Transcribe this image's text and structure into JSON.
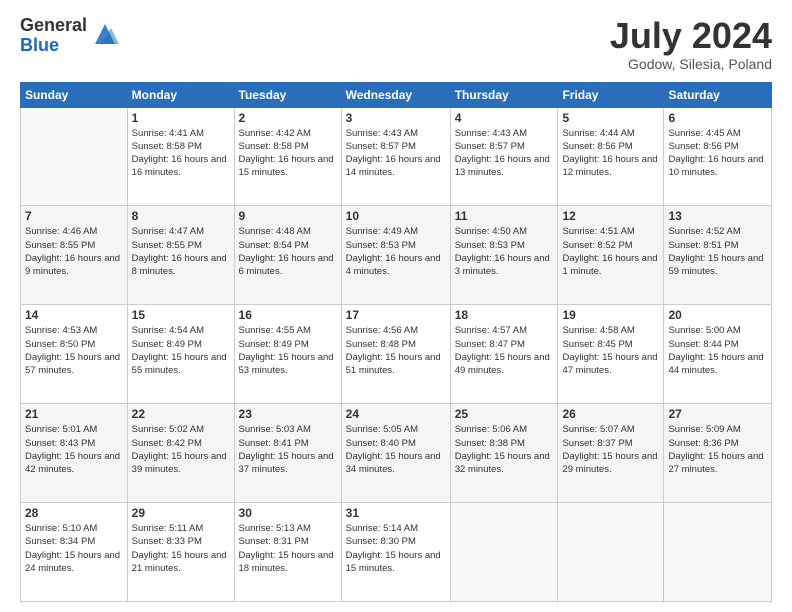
{
  "header": {
    "logo_general": "General",
    "logo_blue": "Blue",
    "month_title": "July 2024",
    "location": "Godow, Silesia, Poland"
  },
  "weekdays": [
    "Sunday",
    "Monday",
    "Tuesday",
    "Wednesday",
    "Thursday",
    "Friday",
    "Saturday"
  ],
  "weeks": [
    [
      {
        "day": "",
        "sunrise": "",
        "sunset": "",
        "daylight": ""
      },
      {
        "day": "1",
        "sunrise": "Sunrise: 4:41 AM",
        "sunset": "Sunset: 8:58 PM",
        "daylight": "Daylight: 16 hours and 16 minutes."
      },
      {
        "day": "2",
        "sunrise": "Sunrise: 4:42 AM",
        "sunset": "Sunset: 8:58 PM",
        "daylight": "Daylight: 16 hours and 15 minutes."
      },
      {
        "day": "3",
        "sunrise": "Sunrise: 4:43 AM",
        "sunset": "Sunset: 8:57 PM",
        "daylight": "Daylight: 16 hours and 14 minutes."
      },
      {
        "day": "4",
        "sunrise": "Sunrise: 4:43 AM",
        "sunset": "Sunset: 8:57 PM",
        "daylight": "Daylight: 16 hours and 13 minutes."
      },
      {
        "day": "5",
        "sunrise": "Sunrise: 4:44 AM",
        "sunset": "Sunset: 8:56 PM",
        "daylight": "Daylight: 16 hours and 12 minutes."
      },
      {
        "day": "6",
        "sunrise": "Sunrise: 4:45 AM",
        "sunset": "Sunset: 8:56 PM",
        "daylight": "Daylight: 16 hours and 10 minutes."
      }
    ],
    [
      {
        "day": "7",
        "sunrise": "Sunrise: 4:46 AM",
        "sunset": "Sunset: 8:55 PM",
        "daylight": "Daylight: 16 hours and 9 minutes."
      },
      {
        "day": "8",
        "sunrise": "Sunrise: 4:47 AM",
        "sunset": "Sunset: 8:55 PM",
        "daylight": "Daylight: 16 hours and 8 minutes."
      },
      {
        "day": "9",
        "sunrise": "Sunrise: 4:48 AM",
        "sunset": "Sunset: 8:54 PM",
        "daylight": "Daylight: 16 hours and 6 minutes."
      },
      {
        "day": "10",
        "sunrise": "Sunrise: 4:49 AM",
        "sunset": "Sunset: 8:53 PM",
        "daylight": "Daylight: 16 hours and 4 minutes."
      },
      {
        "day": "11",
        "sunrise": "Sunrise: 4:50 AM",
        "sunset": "Sunset: 8:53 PM",
        "daylight": "Daylight: 16 hours and 3 minutes."
      },
      {
        "day": "12",
        "sunrise": "Sunrise: 4:51 AM",
        "sunset": "Sunset: 8:52 PM",
        "daylight": "Daylight: 16 hours and 1 minute."
      },
      {
        "day": "13",
        "sunrise": "Sunrise: 4:52 AM",
        "sunset": "Sunset: 8:51 PM",
        "daylight": "Daylight: 15 hours and 59 minutes."
      }
    ],
    [
      {
        "day": "14",
        "sunrise": "Sunrise: 4:53 AM",
        "sunset": "Sunset: 8:50 PM",
        "daylight": "Daylight: 15 hours and 57 minutes."
      },
      {
        "day": "15",
        "sunrise": "Sunrise: 4:54 AM",
        "sunset": "Sunset: 8:49 PM",
        "daylight": "Daylight: 15 hours and 55 minutes."
      },
      {
        "day": "16",
        "sunrise": "Sunrise: 4:55 AM",
        "sunset": "Sunset: 8:49 PM",
        "daylight": "Daylight: 15 hours and 53 minutes."
      },
      {
        "day": "17",
        "sunrise": "Sunrise: 4:56 AM",
        "sunset": "Sunset: 8:48 PM",
        "daylight": "Daylight: 15 hours and 51 minutes."
      },
      {
        "day": "18",
        "sunrise": "Sunrise: 4:57 AM",
        "sunset": "Sunset: 8:47 PM",
        "daylight": "Daylight: 15 hours and 49 minutes."
      },
      {
        "day": "19",
        "sunrise": "Sunrise: 4:58 AM",
        "sunset": "Sunset: 8:45 PM",
        "daylight": "Daylight: 15 hours and 47 minutes."
      },
      {
        "day": "20",
        "sunrise": "Sunrise: 5:00 AM",
        "sunset": "Sunset: 8:44 PM",
        "daylight": "Daylight: 15 hours and 44 minutes."
      }
    ],
    [
      {
        "day": "21",
        "sunrise": "Sunrise: 5:01 AM",
        "sunset": "Sunset: 8:43 PM",
        "daylight": "Daylight: 15 hours and 42 minutes."
      },
      {
        "day": "22",
        "sunrise": "Sunrise: 5:02 AM",
        "sunset": "Sunset: 8:42 PM",
        "daylight": "Daylight: 15 hours and 39 minutes."
      },
      {
        "day": "23",
        "sunrise": "Sunrise: 5:03 AM",
        "sunset": "Sunset: 8:41 PM",
        "daylight": "Daylight: 15 hours and 37 minutes."
      },
      {
        "day": "24",
        "sunrise": "Sunrise: 5:05 AM",
        "sunset": "Sunset: 8:40 PM",
        "daylight": "Daylight: 15 hours and 34 minutes."
      },
      {
        "day": "25",
        "sunrise": "Sunrise: 5:06 AM",
        "sunset": "Sunset: 8:38 PM",
        "daylight": "Daylight: 15 hours and 32 minutes."
      },
      {
        "day": "26",
        "sunrise": "Sunrise: 5:07 AM",
        "sunset": "Sunset: 8:37 PM",
        "daylight": "Daylight: 15 hours and 29 minutes."
      },
      {
        "day": "27",
        "sunrise": "Sunrise: 5:09 AM",
        "sunset": "Sunset: 8:36 PM",
        "daylight": "Daylight: 15 hours and 27 minutes."
      }
    ],
    [
      {
        "day": "28",
        "sunrise": "Sunrise: 5:10 AM",
        "sunset": "Sunset: 8:34 PM",
        "daylight": "Daylight: 15 hours and 24 minutes."
      },
      {
        "day": "29",
        "sunrise": "Sunrise: 5:11 AM",
        "sunset": "Sunset: 8:33 PM",
        "daylight": "Daylight: 15 hours and 21 minutes."
      },
      {
        "day": "30",
        "sunrise": "Sunrise: 5:13 AM",
        "sunset": "Sunset: 8:31 PM",
        "daylight": "Daylight: 15 hours and 18 minutes."
      },
      {
        "day": "31",
        "sunrise": "Sunrise: 5:14 AM",
        "sunset": "Sunset: 8:30 PM",
        "daylight": "Daylight: 15 hours and 15 minutes."
      },
      {
        "day": "",
        "sunrise": "",
        "sunset": "",
        "daylight": ""
      },
      {
        "day": "",
        "sunrise": "",
        "sunset": "",
        "daylight": ""
      },
      {
        "day": "",
        "sunrise": "",
        "sunset": "",
        "daylight": ""
      }
    ]
  ]
}
